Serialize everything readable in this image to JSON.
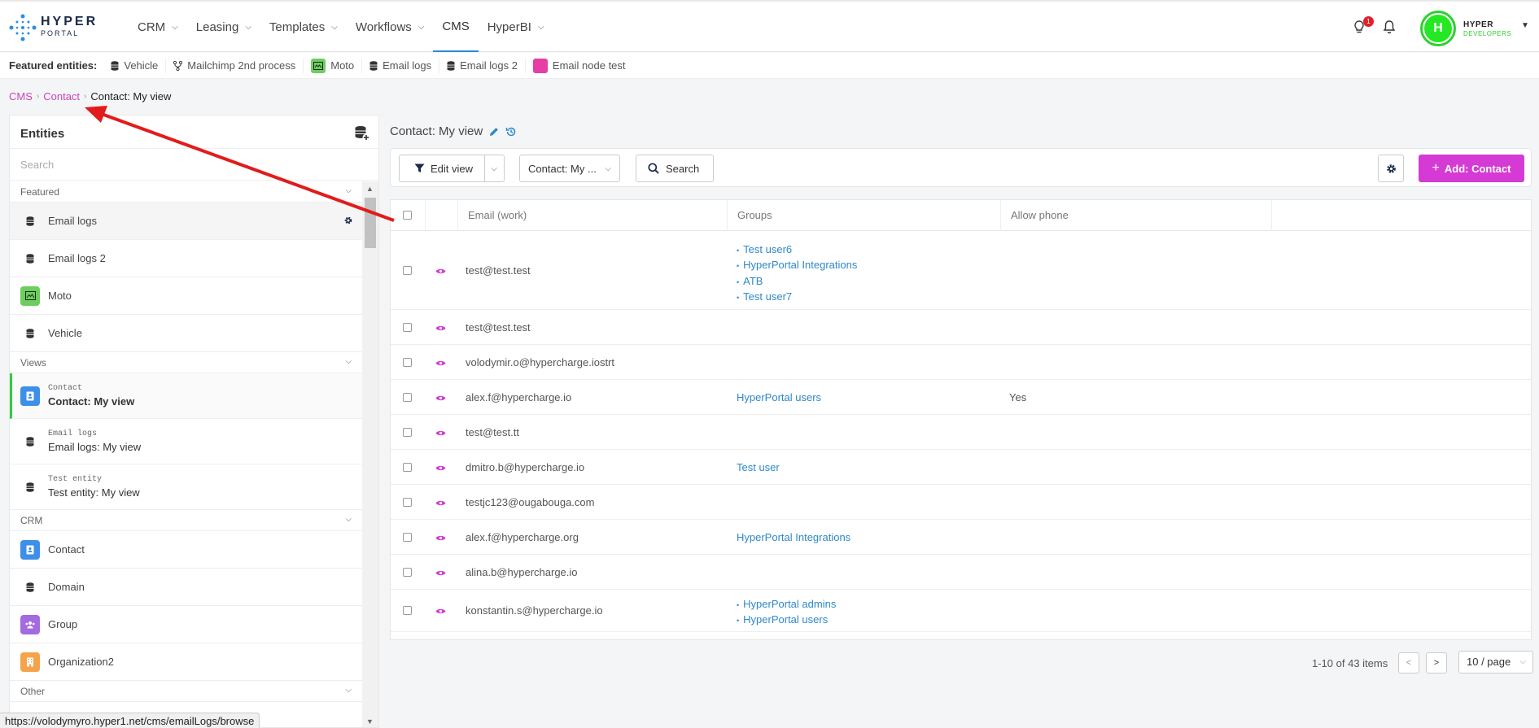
{
  "logo": {
    "line1": "HYPER",
    "line2": "PORTAL"
  },
  "nav": {
    "items": [
      {
        "label": "CRM",
        "has_dropdown": true
      },
      {
        "label": "Leasing",
        "has_dropdown": true
      },
      {
        "label": "Templates",
        "has_dropdown": true
      },
      {
        "label": "Workflows",
        "has_dropdown": true
      },
      {
        "label": "CMS",
        "has_dropdown": false,
        "active": true
      },
      {
        "label": "HyperBI",
        "has_dropdown": true
      }
    ]
  },
  "header": {
    "notification_count": "1",
    "avatar_letter": "H",
    "org_name": "HYPER",
    "org_sub": "DEVELOPERS"
  },
  "featured": {
    "label": "Featured entities:",
    "items": [
      {
        "label": "Vehicle",
        "icon": "database-icon"
      },
      {
        "label": "Mailchimp 2nd process",
        "icon": "workflow-icon"
      },
      {
        "label": "Moto",
        "icon": "moto-icon"
      },
      {
        "label": "Email logs",
        "icon": "database-icon"
      },
      {
        "label": "Email logs 2",
        "icon": "database-icon"
      },
      {
        "label": "Email node test",
        "icon": "pink-square-icon"
      }
    ]
  },
  "breadcrumb": {
    "root": "CMS",
    "parent": "Contact",
    "current": "Contact: My view"
  },
  "sidebar": {
    "title": "Entities",
    "search_placeholder": "Search",
    "groups": {
      "featured": "Featured",
      "views": "Views",
      "crm": "CRM",
      "other": "Other"
    },
    "featured_items": [
      "Email logs",
      "Email logs 2",
      "Moto",
      "Vehicle"
    ],
    "views": [
      {
        "entity": "Contact",
        "name": "Contact: My view"
      },
      {
        "entity": "Email logs",
        "name": "Email logs: My view"
      },
      {
        "entity": "Test entity",
        "name": "Test entity: My view"
      }
    ],
    "crm_items": [
      "Contact",
      "Domain",
      "Group",
      "Organization2"
    ]
  },
  "status_url": "https://volodymyro.hyper1.net/cms/emailLogs/browse",
  "main": {
    "view_title": "Contact: My view",
    "toolbar": {
      "edit_view": "Edit view",
      "view_select": "Contact: My ...",
      "search": "Search",
      "add": "Add: Contact"
    },
    "table": {
      "columns": [
        "Email (work)",
        "Groups",
        "Allow phone"
      ],
      "rows": [
        {
          "email": "test@test.test",
          "groups": [
            "Test user6",
            "HyperPortal Integrations",
            "ATB",
            "Test user7"
          ],
          "phone": ""
        },
        {
          "email": "test@test.test",
          "groups": [],
          "phone": ""
        },
        {
          "email": "volodymir.o@hypercharge.iostrt",
          "groups": [],
          "phone": ""
        },
        {
          "email": "alex.f@hypercharge.io",
          "groups": [
            "HyperPortal users"
          ],
          "phone": "Yes"
        },
        {
          "email": "test@test.tt",
          "groups": [],
          "phone": ""
        },
        {
          "email": "dmitro.b@hypercharge.io",
          "groups": [
            "Test user"
          ],
          "phone": ""
        },
        {
          "email": "testjc123@ougabouga.com",
          "groups": [],
          "phone": ""
        },
        {
          "email": "alex.f@hypercharge.org",
          "groups": [
            "HyperPortal Integrations"
          ],
          "phone": ""
        },
        {
          "email": "alina.b@hypercharge.io",
          "groups": [],
          "phone": ""
        },
        {
          "email": "konstantin.s@hypercharge.io",
          "groups": [
            "HyperPortal admins",
            "HyperPortal users"
          ],
          "phone": ""
        }
      ]
    },
    "pagination": {
      "summary": "1-10 of 43 items",
      "page_size": "10 / page"
    }
  },
  "colors": {
    "accent": "#d63ad4",
    "link": "#2f88c9",
    "breadcrumb": "#c845b8",
    "annotation_arrow": "#e21b1b"
  }
}
